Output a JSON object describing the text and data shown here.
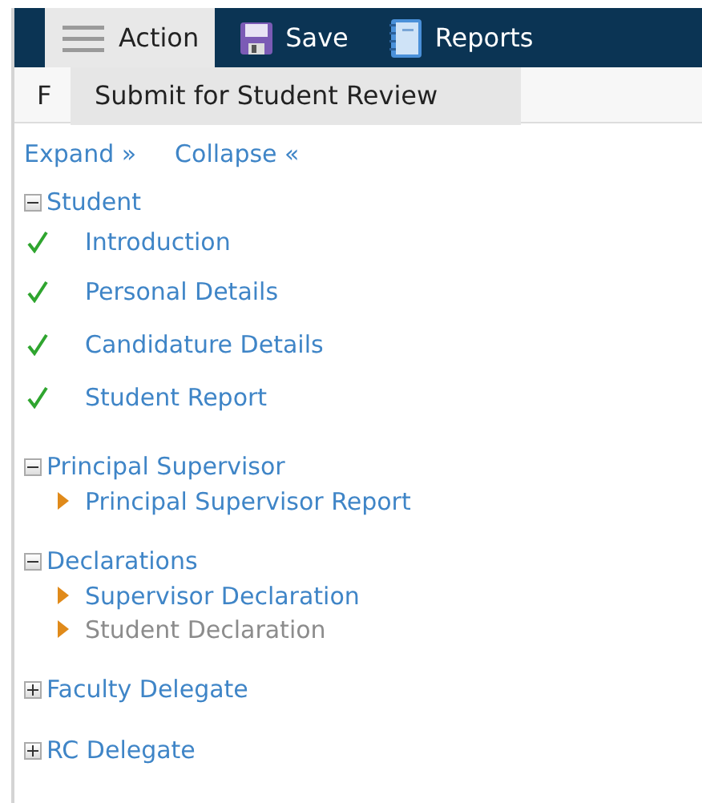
{
  "toolbar": {
    "buttons": [
      {
        "label": "Action",
        "kind": "menu",
        "selected": true
      },
      {
        "label": "Save",
        "kind": "save",
        "selected": false
      },
      {
        "label": "Reports",
        "kind": "reports",
        "selected": false
      }
    ]
  },
  "action_menu": {
    "items": [
      "Submit for Student Review"
    ]
  },
  "tab_strip": {
    "label": "F"
  },
  "tree_controls": {
    "expand": "Expand »",
    "collapse": "Collapse «"
  },
  "tree": [
    {
      "label": "Student",
      "expanded": true,
      "children": [
        {
          "label": "Introduction",
          "kind": "check",
          "disabled": false
        },
        {
          "label": "Personal Details",
          "kind": "check",
          "disabled": false
        },
        {
          "label": "Candidature Details",
          "kind": "check",
          "disabled": false
        },
        {
          "label": "Student Report",
          "kind": "check",
          "disabled": false
        }
      ]
    },
    {
      "label": "Principal Supervisor",
      "expanded": true,
      "children": [
        {
          "label": "Principal Supervisor Report",
          "kind": "arrow",
          "disabled": false
        }
      ]
    },
    {
      "label": "Declarations",
      "expanded": true,
      "children": [
        {
          "label": "Supervisor Declaration",
          "kind": "arrow",
          "disabled": false
        },
        {
          "label": "Student Declaration",
          "kind": "arrow",
          "disabled": true
        }
      ]
    },
    {
      "label": "Faculty Delegate",
      "expanded": false
    },
    {
      "label": "RC Delegate",
      "expanded": false
    }
  ]
}
